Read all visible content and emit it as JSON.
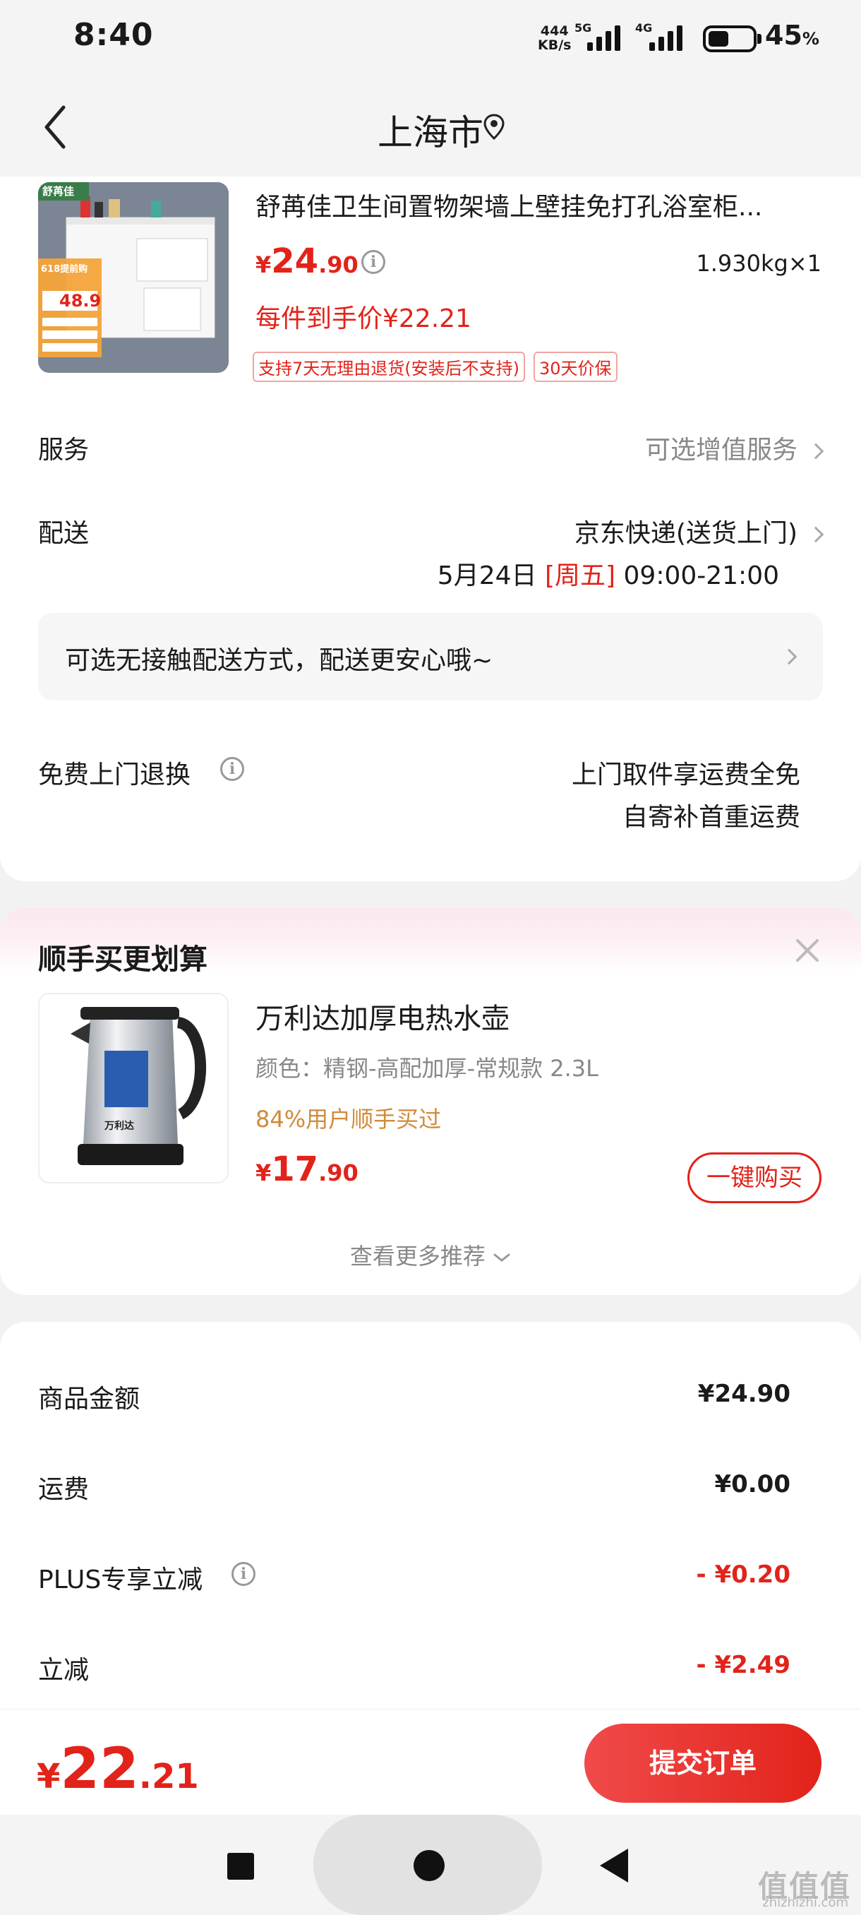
{
  "status_bar": {
    "time": "8:40",
    "net_speed_value": "444",
    "net_speed_unit": "KB/s",
    "sim1_label": "5G",
    "sim2_label": "4G",
    "battery_percent": "45",
    "battery_percent_unit": "%"
  },
  "nav": {
    "title": "上海市",
    "back_icon": "chevron-left-icon",
    "location_icon": "location-pin-icon"
  },
  "product": {
    "title": "舒苒佳卫生间置物架墙上壁挂免打孔浴室柜...",
    "price_symbol": "¥",
    "price_int": "24",
    "price_dec": ".90",
    "weight_qty": "1.930kg×1",
    "final_price": "每件到手价¥22.21",
    "tags": [
      "支持7天无理由退货(安装后不支持)",
      "30天价保"
    ],
    "image_brand": "舒苒佳",
    "image_badge": "618提前购",
    "image_price": "48.9"
  },
  "service": {
    "label": "服务",
    "value": "可选增值服务"
  },
  "delivery": {
    "label": "配送",
    "method": "京东快递(送货上门)",
    "date": "5月24日",
    "weekday": "[周五]",
    "time_window": "09:00-21:00"
  },
  "contactless": {
    "text": "可选无接触配送方式，配送更安心哦~"
  },
  "free_return": {
    "label": "免费上门退换",
    "line1": "上门取件享运费全免",
    "line2": "自寄补首重运费"
  },
  "addon": {
    "section_title": "顺手买更划算",
    "item_title": "万利达加厚电热水壶",
    "item_spec": "颜色：精钢-高配加厚-常规款 2.3L",
    "item_stat": "84%用户顺手买过",
    "price_symbol": "¥",
    "price_int": "17",
    "price_dec": ".90",
    "buy_label": "一键购买",
    "more_label": "查看更多推荐",
    "kettle_brand": "万利达"
  },
  "summary": {
    "rows": [
      {
        "label": "商品金额",
        "value": "¥24.90"
      },
      {
        "label": "运费",
        "value": "¥0.00"
      },
      {
        "label": "PLUS专享立减",
        "value": "- ¥0.20"
      },
      {
        "label": "立减",
        "value": "- ¥2.49"
      }
    ]
  },
  "bottom": {
    "total_symbol": "¥",
    "total_int": "22",
    "total_dec": ".21",
    "submit_label": "提交订单"
  },
  "watermark": {
    "text": "值值值",
    "sub": "zhizhizhi.com"
  },
  "colors": {
    "accent_red": "#e2231a",
    "stat_orange": "#d08a3a"
  }
}
